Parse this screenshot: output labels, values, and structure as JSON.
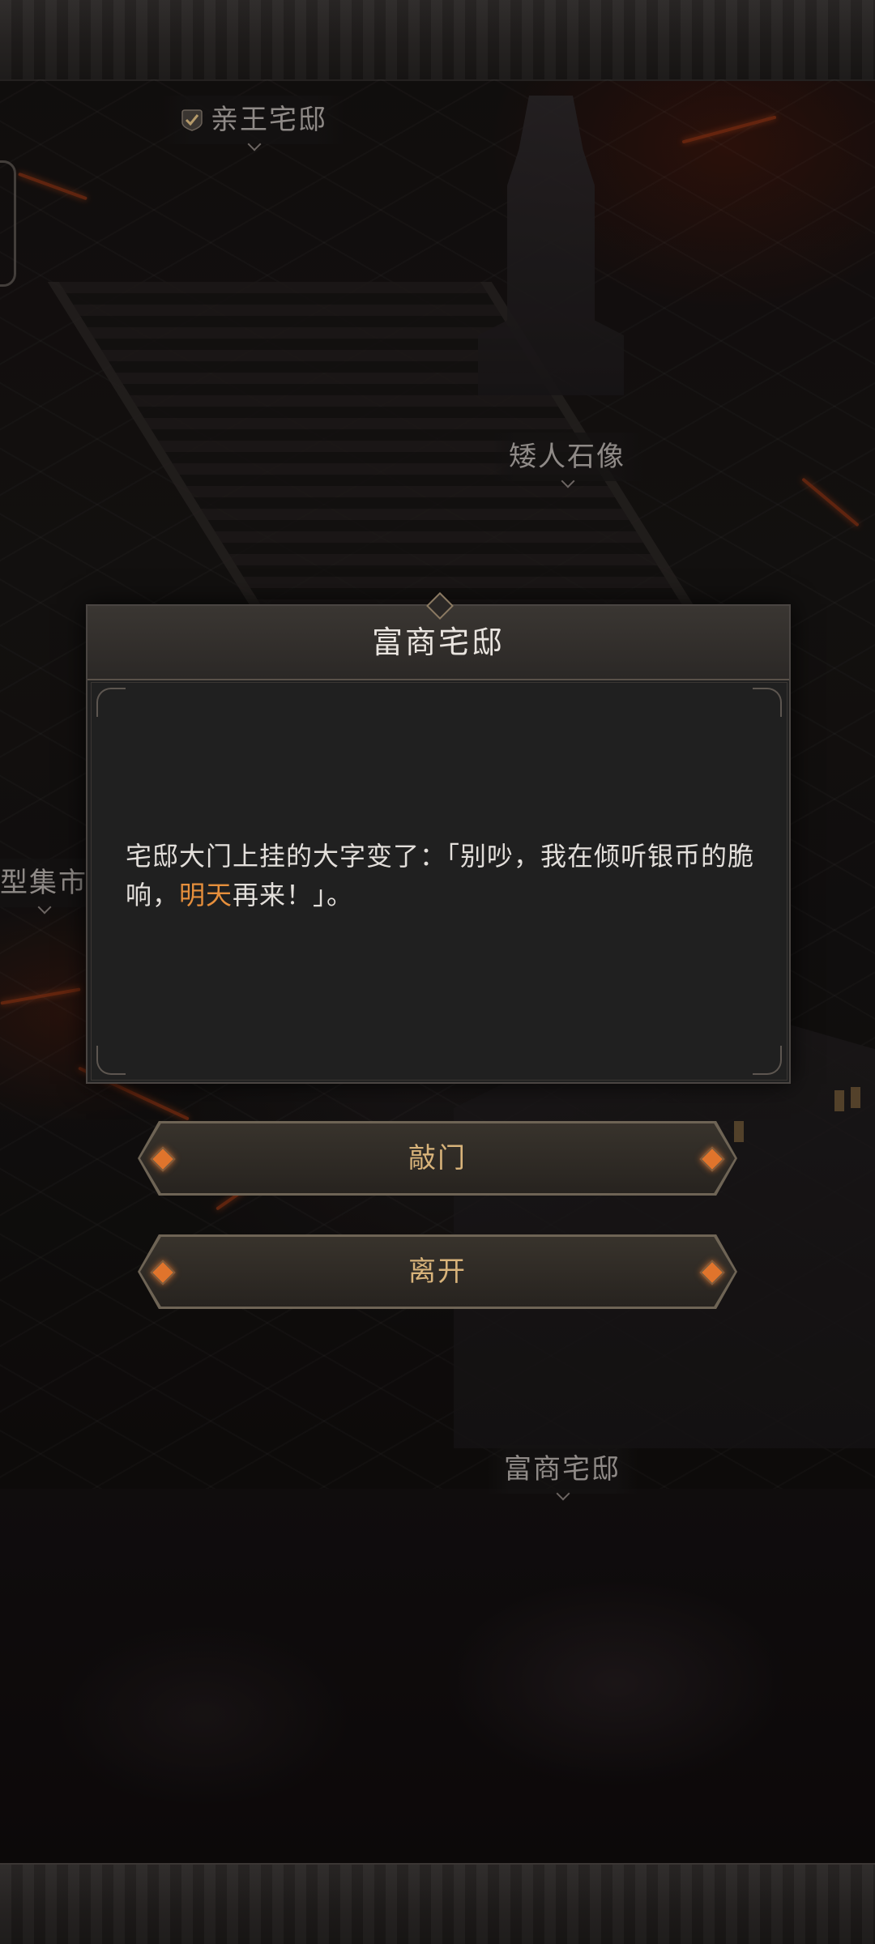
{
  "map": {
    "labels": {
      "prince_mansion": "亲王宅邸",
      "dwarf_statue": "矮人石像",
      "market_partial": "型集市",
      "merchant_mansion": "富商宅邸"
    },
    "prince_mansion_checked": true
  },
  "dialog": {
    "title": "富商宅邸",
    "message_before": "宅邸大门上挂的大字变了：「别吵，我在倾听银币的脆响，",
    "message_highlight": "明天",
    "message_after": "再来！」。",
    "highlight_color": "#e68f3c"
  },
  "actions": {
    "knock_label": "敲门",
    "leave_label": "离开"
  },
  "icons": {
    "check": "check-icon",
    "gem": "gem-icon"
  }
}
